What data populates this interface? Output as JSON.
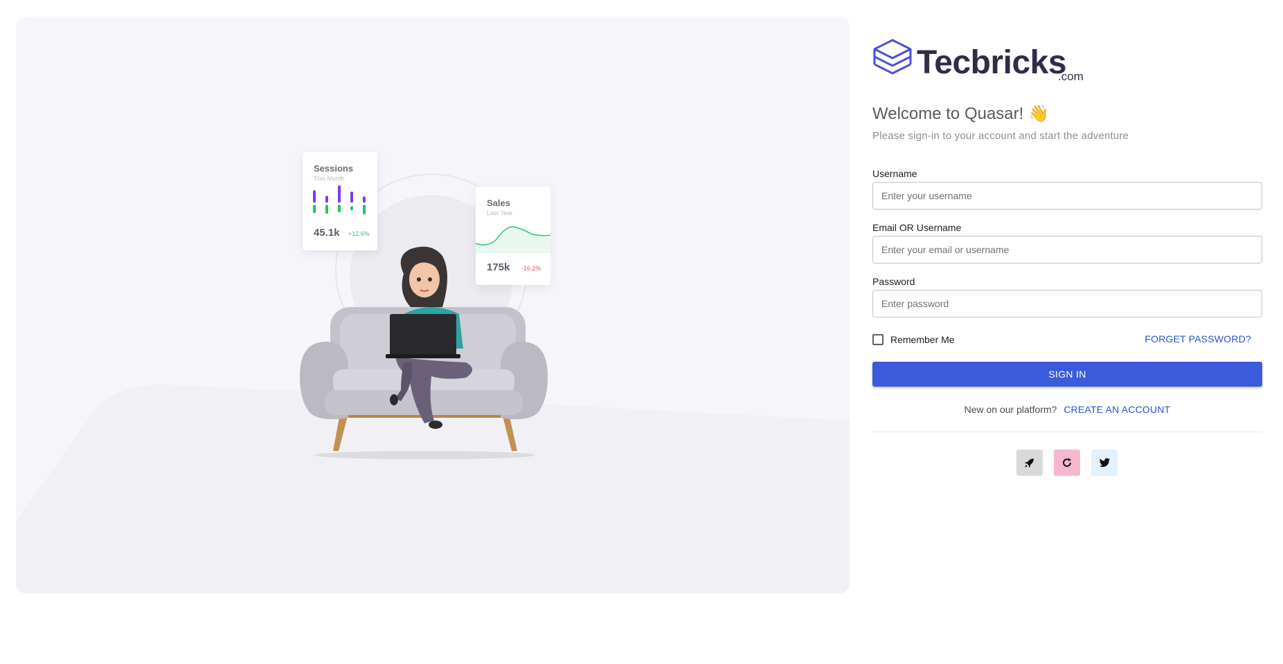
{
  "brand": {
    "name": "Tecbricks",
    "tld": ".com",
    "color": "#4b4fd6"
  },
  "welcome": {
    "title": "Welcome to Quasar! 👋",
    "subtitle": "Please sign-in to your account and start the adventure"
  },
  "form": {
    "username": {
      "label": "Username",
      "placeholder": "Enter your username"
    },
    "email": {
      "label": "Email OR Username",
      "placeholder": "Enter your email or username"
    },
    "password": {
      "label": "Password",
      "placeholder": "Enter password"
    },
    "remember_label": "Remember Me",
    "forgot_label": "FORGET PASSWORD?",
    "signin_label": "SIGN IN",
    "new_text": "New on our platform?",
    "create_label": "CREATE AN ACCOUNT"
  },
  "social": [
    {
      "icon": "rocket-icon",
      "bg": "#d9d9d9"
    },
    {
      "icon": "refresh-icon",
      "bg": "#f7b6cf"
    },
    {
      "icon": "twitter-icon",
      "bg": "#e3f1fd"
    }
  ],
  "illustration": {
    "sessions": {
      "title": "Sessions",
      "subtitle": "This Month",
      "value": "45.1k",
      "delta": "+12.6%",
      "delta_color": "#28c76f"
    },
    "sales": {
      "title": "Sales",
      "subtitle": "Last Year",
      "value": "175k",
      "delta": "-16.2%",
      "delta_color": "#ea5455"
    }
  },
  "colors": {
    "primary": "#3a5bdb",
    "link": "#2a50d6",
    "panel_bg": "#f6f5fa"
  }
}
